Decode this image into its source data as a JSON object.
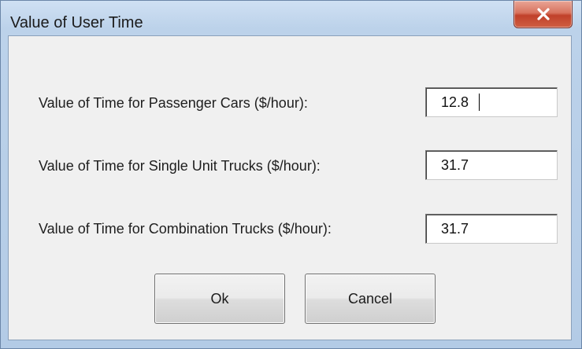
{
  "window": {
    "title": "Value of User Time"
  },
  "title_bar": {
    "close_icon": "close-x-icon",
    "close_color": "#c7452f"
  },
  "fields": [
    {
      "label": "Value of Time for Passenger Cars ($/hour):",
      "value": "12.8"
    },
    {
      "label": "Value of Time for Single Unit Trucks ($/hour):",
      "value": "31.7"
    },
    {
      "label": "Value of Time for Combination Trucks ($/hour):",
      "value": "31.7"
    }
  ],
  "buttons": {
    "ok_label": "Ok",
    "cancel_label": "Cancel"
  }
}
